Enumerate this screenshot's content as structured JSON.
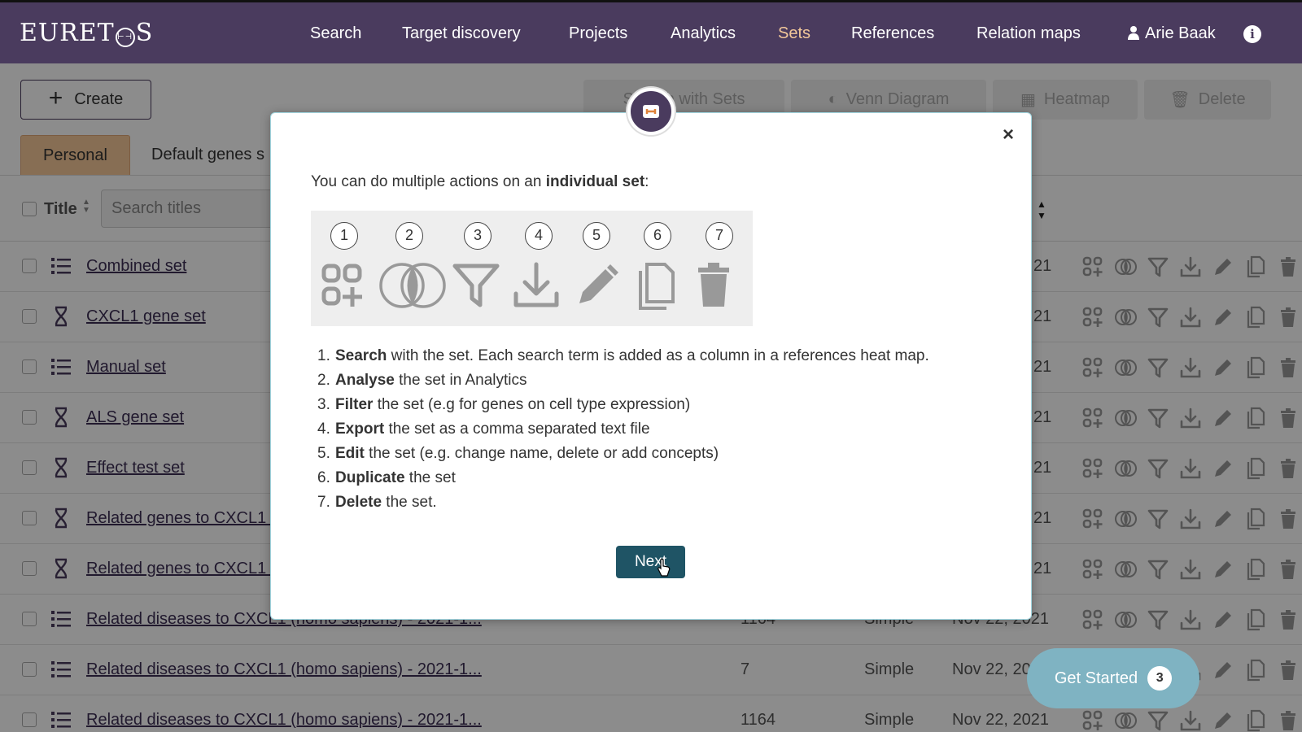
{
  "brand": "EURETOS",
  "nav": {
    "items": [
      "Search",
      "Target discovery",
      "Projects",
      "Analytics",
      "Sets",
      "References",
      "Relation maps"
    ],
    "active": "Sets",
    "user": "Arie Baak"
  },
  "toolbar": {
    "create_label": "Create",
    "search_with_sets": "Search with Sets",
    "venn": "Venn Diagram",
    "heatmap": "Heatmap",
    "delete": "Delete"
  },
  "tabs": [
    "Personal",
    "Default genes s"
  ],
  "table": {
    "title_header": "Title",
    "search_placeholder": "Search titles",
    "rows": [
      {
        "title": "Combined set",
        "type": "list",
        "count": "",
        "kind": "",
        "date": "21"
      },
      {
        "title": "CXCL1 gene set",
        "type": "gene",
        "count": "",
        "kind": "",
        "date": "21"
      },
      {
        "title": "Manual set",
        "type": "list",
        "count": "",
        "kind": "",
        "date": "21"
      },
      {
        "title": "ALS gene set",
        "type": "gene",
        "count": "",
        "kind": "",
        "date": "21"
      },
      {
        "title": "Effect test set",
        "type": "gene",
        "count": "",
        "kind": "",
        "date": "21"
      },
      {
        "title": "Related genes to CXCL1 (",
        "type": "gene",
        "count": "",
        "kind": "",
        "date": "21"
      },
      {
        "title": "Related genes to CXCL1 (",
        "type": "gene",
        "count": "",
        "kind": "",
        "date": "21"
      },
      {
        "title": "Related diseases to CXCL1 (homo sapiens) - 2021-1...",
        "type": "list",
        "count": "1164",
        "kind": "Simple",
        "date": "Nov 22, 2021"
      },
      {
        "title": "Related diseases to CXCL1 (homo sapiens) - 2021-1...",
        "type": "list",
        "count": "7",
        "kind": "Simple",
        "date": "Nov 22, 20"
      },
      {
        "title": "Related diseases to CXCL1 (homo sapiens) - 2021-1...",
        "type": "list",
        "count": "1164",
        "kind": "Simple",
        "date": "Nov 22, 2021"
      }
    ]
  },
  "modal": {
    "intro_prefix": "You can do multiple actions on an ",
    "intro_bold": "individual set",
    "intro_suffix": ":",
    "numbers": [
      "1",
      "2",
      "3",
      "4",
      "5",
      "6",
      "7"
    ],
    "icons": [
      "search-set-icon",
      "venn-icon",
      "filter-icon",
      "download-icon",
      "edit-icon",
      "duplicate-icon",
      "delete-icon"
    ],
    "steps": [
      {
        "n": "1.",
        "bold": "Search",
        "rest": " with the set. Each search term is added as a column in a references heat map."
      },
      {
        "n": "2.",
        "bold": "Analyse",
        "rest": " the set in Analytics"
      },
      {
        "n": "3.",
        "bold": "Filter",
        "rest": " the set (e.g for genes on cell type expression)"
      },
      {
        "n": "4.",
        "bold": "Export",
        "rest": " the set as a comma separated text file"
      },
      {
        "n": "5.",
        "bold": "Edit",
        "rest": " the set (e.g. change name, delete or add concepts)"
      },
      {
        "n": "6.",
        "bold": "Duplicate",
        "rest": " the set"
      },
      {
        "n": "7.",
        "bold": "Delete",
        "rest": " the set."
      }
    ],
    "close": "×",
    "next_label": "Next"
  },
  "get_started": {
    "label": "Get Started",
    "count": "3"
  },
  "colors": {
    "header": "#4a3b5e",
    "active_nav": "#f2c79a",
    "tab_active": "#f6c99a",
    "next_button": "#1f5465",
    "get_started": "#7fb3c2"
  }
}
